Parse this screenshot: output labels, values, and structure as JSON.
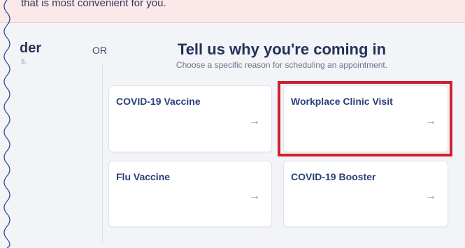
{
  "banner": {
    "text": "that is most convenient for you."
  },
  "left_panel": {
    "heading": "der",
    "subtext": "s."
  },
  "or_label": "OR",
  "reasons": {
    "title": "Tell us why you're coming in",
    "subtitle": "Choose a specific reason for scheduling an appointment.",
    "cards": [
      {
        "label": "COVID-19 Vaccine",
        "arrow": "→"
      },
      {
        "label": "Workplace Clinic Visit",
        "arrow": "→"
      },
      {
        "label": "Flu Vaccine",
        "arrow": "→"
      },
      {
        "label": "COVID-19 Booster",
        "arrow": "→"
      }
    ]
  },
  "colors": {
    "highlight": "#d0202e",
    "banner_bg": "#fbe9ea",
    "accent": "#2a3f7a"
  }
}
